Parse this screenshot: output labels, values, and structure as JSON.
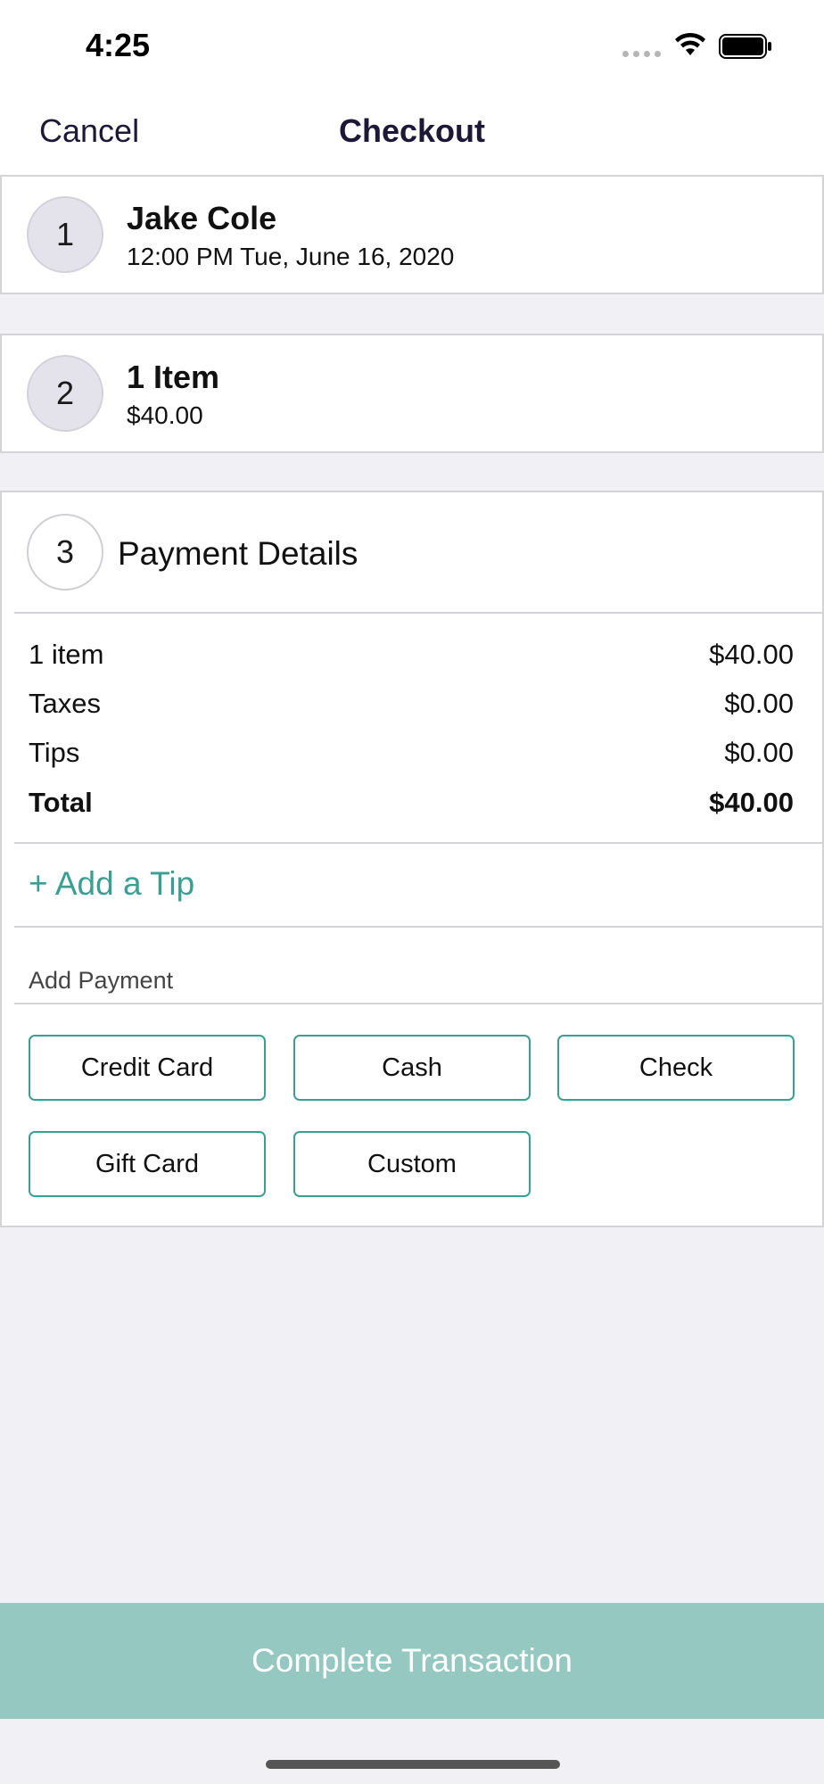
{
  "status_bar": {
    "time": "4:25"
  },
  "nav": {
    "cancel_label": "Cancel",
    "title": "Checkout"
  },
  "steps": [
    {
      "number": "1",
      "title": "Jake Cole",
      "subtitle": "12:00 PM Tue, June 16, 2020"
    },
    {
      "number": "2",
      "title": "1 Item",
      "subtitle": "$40.00"
    },
    {
      "number": "3",
      "title": "Payment Details"
    }
  ],
  "summary": [
    {
      "label": "1 item",
      "value": "$40.00"
    },
    {
      "label": "Taxes",
      "value": "$0.00"
    },
    {
      "label": "Tips",
      "value": "$0.00"
    },
    {
      "label": "Total",
      "value": "$40.00"
    }
  ],
  "add_tip_label": "+ Add a Tip",
  "add_payment_label": "Add Payment",
  "payment_methods": [
    "Credit Card",
    "Cash",
    "Check",
    "Gift Card",
    "Custom"
  ],
  "complete_label": "Complete Transaction",
  "colors": {
    "accent": "#3a9f92",
    "complete_bg": "#96c8c2",
    "nav_text": "#1c1836"
  },
  "icons": [
    "signal-icon",
    "wifi-icon",
    "battery-icon"
  ]
}
